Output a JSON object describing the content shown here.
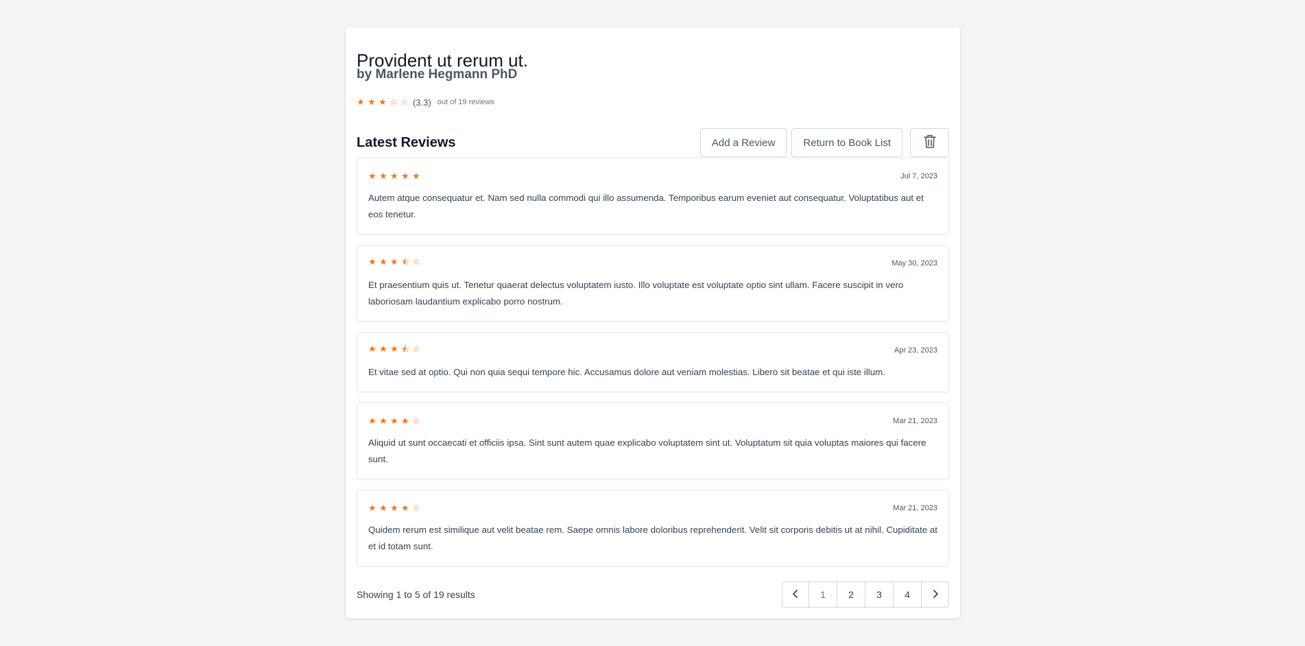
{
  "book": {
    "title": "Provident ut rerum ut.",
    "author": "by Marlene Hegmann PhD",
    "rating_display": "(3.3)",
    "rating_value": 3.3,
    "review_count_text": "out of 19 reviews"
  },
  "section": {
    "title": "Latest Reviews",
    "add_review_label": "Add a Review",
    "return_label": "Return to Book List",
    "delete_icon": "trash-icon"
  },
  "reviews": [
    {
      "rating": 5,
      "date": "Jul 7, 2023",
      "text": "Autem atque consequatur et. Nam sed nulla commodi qui illo assumenda. Temporibus earum eveniet aut consequatur. Voluptatibus aut et eos tenetur."
    },
    {
      "rating": 3.5,
      "date": "May 30, 2023",
      "text": "Et praesentium quis ut. Tenetur quaerat delectus voluptatem iusto. Illo voluptate est voluptate optio sint ullam. Facere suscipit in vero laboriosam laudantium explicabo porro nostrum."
    },
    {
      "rating": 3.5,
      "date": "Apr 23, 2023",
      "text": "Et vitae sed at optio. Qui non quia sequi tempore hic. Accusamus dolore aut veniam molestias. Libero sit beatae et qui iste illum."
    },
    {
      "rating": 4,
      "date": "Mar 21, 2023",
      "text": "Aliquid ut sunt occaecati et officiis ipsa. Sint sunt autem quae explicabo voluptatem sint ut. Voluptatum sit quia voluptas maiores qui facere sunt."
    },
    {
      "rating": 4,
      "date": "Mar 21, 2023",
      "text": "Quidem rerum est similique aut velit beatae rem. Saepe omnis labore doloribus reprehenderit. Velit sit corporis debitis ut at nihil. Cupiditate at et id totam sunt."
    }
  ],
  "pagination": {
    "showing_text": "Showing 1 to 5 of 19 results",
    "pages": [
      "1",
      "2",
      "3",
      "4"
    ],
    "current_page": "1",
    "prev_icon": "chevron-left-icon",
    "next_icon": "chevron-right-icon"
  },
  "colors": {
    "star": "#f97316",
    "background": "#f3f4f6"
  }
}
